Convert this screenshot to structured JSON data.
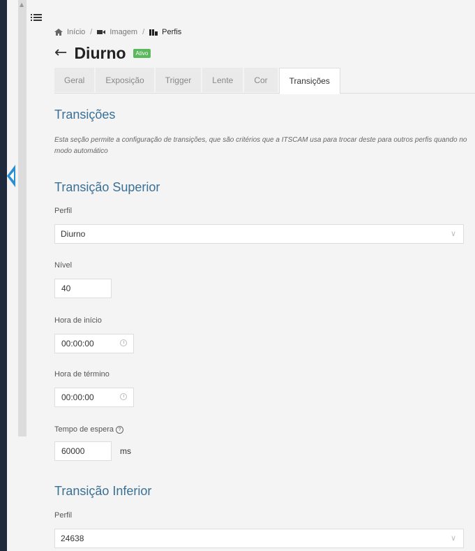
{
  "breadcrumb": {
    "home": "Início",
    "image": "Imagem",
    "current": "Perfis"
  },
  "page": {
    "title": "Diurno",
    "status": "Ativo"
  },
  "tabs": [
    {
      "label": "Geral",
      "active": false
    },
    {
      "label": "Exposição",
      "active": false
    },
    {
      "label": "Trigger",
      "active": false
    },
    {
      "label": "Lente",
      "active": false
    },
    {
      "label": "Cor",
      "active": false
    },
    {
      "label": "Transições",
      "active": true
    }
  ],
  "section": {
    "title": "Transições",
    "description": "Esta seção permite a configuração de transições, que são critérios que a ITSCAM usa para trocar deste para outros perfis quando no modo automático"
  },
  "upper": {
    "title": "Transição Superior",
    "profile_label": "Perfil",
    "profile_value": "Diurno",
    "level_label": "Nível",
    "level_value": "40",
    "start_label": "Hora de início",
    "start_value": "00:00:00",
    "end_label": "Hora de término",
    "end_value": "00:00:00",
    "wait_label": "Tempo de espera",
    "wait_value": "60000",
    "wait_unit": "ms"
  },
  "lower": {
    "title": "Transição Inferior",
    "profile_label": "Perfil",
    "profile_value": "24638"
  },
  "colors": {
    "sidebar": "#1f2a3c",
    "accent": "#2a8fd0",
    "section_title": "#3a6f96",
    "badge": "#5cb85c"
  },
  "icons": [
    "menu-icon",
    "home-icon",
    "camera-icon",
    "profiles-icon",
    "back-arrow-icon",
    "chevron-down-icon",
    "clock-icon",
    "help-icon",
    "collapse-arrow-icon"
  ]
}
